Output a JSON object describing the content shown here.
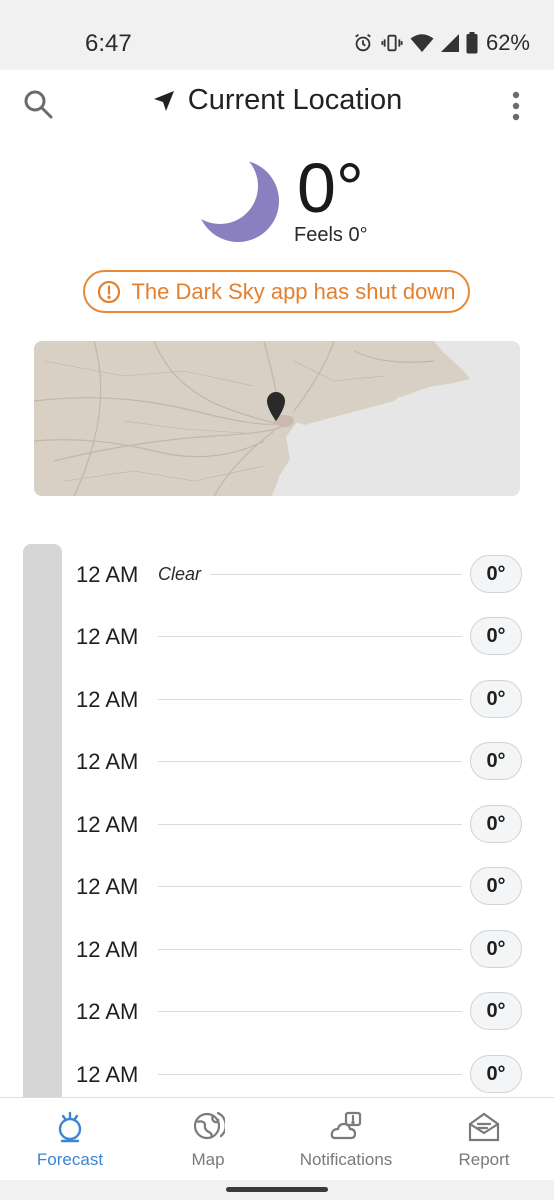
{
  "status_bar": {
    "time": "6:47",
    "battery": "62%",
    "icons": [
      "alarm-icon",
      "vibrate-icon",
      "wifi-icon",
      "signal-icon",
      "battery-icon"
    ]
  },
  "header": {
    "location_title": "Current Location",
    "icons": [
      "search-icon",
      "location-arrow-icon",
      "more-vert-icon"
    ]
  },
  "current": {
    "temperature": "0°",
    "feels_like": "Feels 0°",
    "condition_icon": "moon-icon",
    "moon_color": "#8a80c0"
  },
  "alert": {
    "text": "The Dark Sky app has shut down",
    "color": "#e2802f",
    "icon": "alert-circle-icon"
  },
  "map": {
    "icon": "map-pin-icon"
  },
  "hourly": [
    {
      "time": "12 AM",
      "summary": "Clear",
      "temp": "0°"
    },
    {
      "time": "12 AM",
      "summary": "",
      "temp": "0°"
    },
    {
      "time": "12 AM",
      "summary": "",
      "temp": "0°"
    },
    {
      "time": "12 AM",
      "summary": "",
      "temp": "0°"
    },
    {
      "time": "12 AM",
      "summary": "",
      "temp": "0°"
    },
    {
      "time": "12 AM",
      "summary": "",
      "temp": "0°"
    },
    {
      "time": "12 AM",
      "summary": "",
      "temp": "0°"
    },
    {
      "time": "12 AM",
      "summary": "",
      "temp": "0°"
    },
    {
      "time": "12 AM",
      "summary": "",
      "temp": "0°"
    }
  ],
  "bottom_nav": {
    "items": [
      {
        "label": "Forecast",
        "icon": "forecast-icon",
        "active": true
      },
      {
        "label": "Map",
        "icon": "globe-icon",
        "active": false
      },
      {
        "label": "Notifications",
        "icon": "notifications-icon",
        "active": false
      },
      {
        "label": "Report",
        "icon": "report-icon",
        "active": false
      }
    ],
    "active_color": "#3b86d4"
  }
}
